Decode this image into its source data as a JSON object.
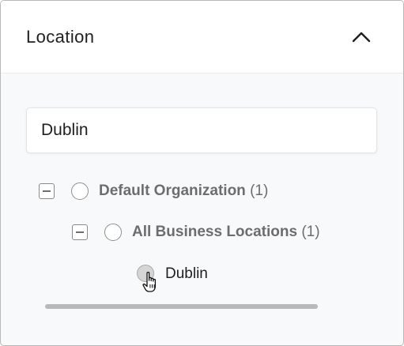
{
  "filter_panel": {
    "title": "Location",
    "expanded": true,
    "collapse_icon": "chevron-up-icon"
  },
  "search": {
    "value": "Dublin",
    "placeholder": ""
  },
  "tree": {
    "root": {
      "label": "Default Organization",
      "count": "(1)",
      "expanded": true,
      "selected": false
    },
    "child": {
      "label": "All Business Locations",
      "count": "(1)",
      "expanded": true,
      "selected": false
    },
    "leaf": {
      "label": "Dublin",
      "selected": false,
      "hovered": true
    }
  },
  "colors": {
    "panel_background": "#f7f9fa",
    "header_background": "#ffffff",
    "muted_text": "#6d6d6d",
    "scrollbar": "#b9b9b9"
  }
}
